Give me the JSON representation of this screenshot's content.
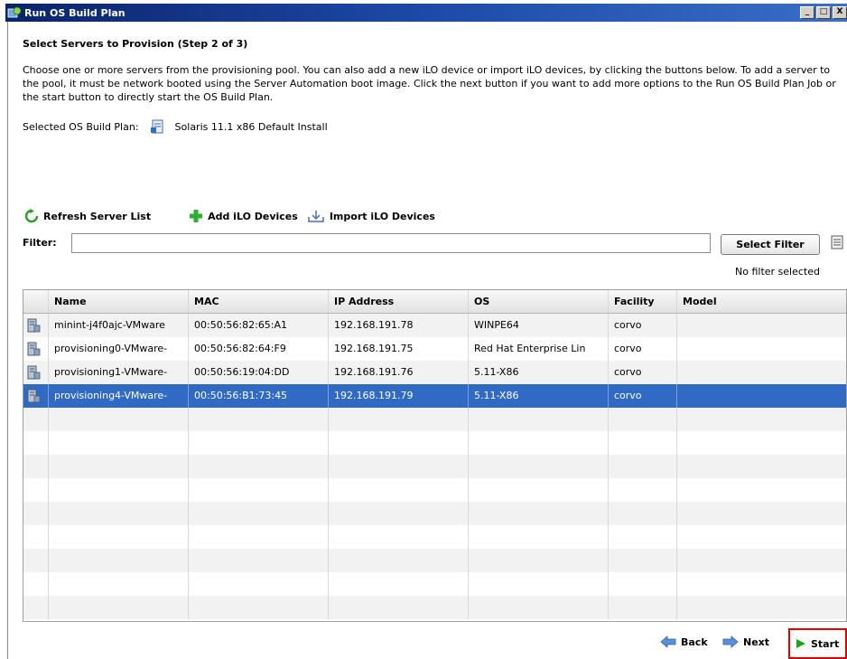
{
  "window": {
    "title": "Run OS Build Plan",
    "minimize_label": "_",
    "maximize_label": "□",
    "close_label": "X"
  },
  "step": {
    "heading": "Select Servers to Provision (Step 2 of 3)",
    "description": "Choose one or more servers from the provisioning pool. You can also add a new iLO device or import iLO devices, by clicking the buttons below. To add a server to the pool, it must be network booted using the Server Automation boot image. Click the next button if you want to add more options to the Run OS Build Plan Job or the start button to directly start the OS Build Plan.",
    "selected_plan_label": "Selected OS Build Plan:",
    "selected_plan_value": "Solaris 11.1 x86 Default Install"
  },
  "actions": {
    "refresh": "Refresh Server List",
    "add_ilo": "Add iLO Devices",
    "import_ilo": "Import iLO Devices"
  },
  "filter": {
    "label": "Filter:",
    "value": "",
    "button": "Select Filter",
    "status": "No filter selected"
  },
  "table": {
    "columns": [
      "Name",
      "MAC",
      "IP Address",
      "OS",
      "Facility",
      "Model"
    ],
    "rows": [
      {
        "name": "minint-j4f0ajc-VMware",
        "mac": "00:50:56:82:65:A1",
        "ip": "192.168.191.78",
        "os": "WINPE64",
        "facility": "corvo",
        "model": "",
        "selected": false
      },
      {
        "name": "provisioning0-VMware-",
        "mac": "00:50:56:82:64:F9",
        "ip": "192.168.191.75",
        "os": "Red Hat Enterprise Lin",
        "facility": "corvo",
        "model": "",
        "selected": false
      },
      {
        "name": "provisioning1-VMware-",
        "mac": "00:50:56:19:04:DD",
        "ip": "192.168.191.76",
        "os": "5.11-X86",
        "facility": "corvo",
        "model": "",
        "selected": false
      },
      {
        "name": "provisioning4-VMware-",
        "mac": "00:50:56:B1:73:45",
        "ip": "192.168.191.79",
        "os": "5.11-X86",
        "facility": "corvo",
        "model": "",
        "selected": true
      }
    ]
  },
  "footer": {
    "back": "Back",
    "next": "Next",
    "start": "Start"
  },
  "colors": {
    "title_bar": "#0a246a",
    "selection": "#316ac5",
    "highlight_box": "#e00000",
    "start_arrow": "#1fa01f"
  }
}
